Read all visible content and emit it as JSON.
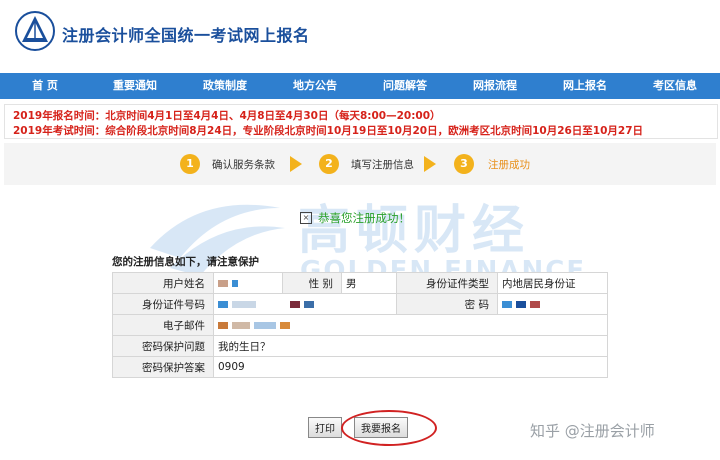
{
  "header": {
    "site_title": "注册会计师全国统一考试网上报名"
  },
  "nav": [
    "首 页",
    "重要通知",
    "政策制度",
    "地方公告",
    "问题解答",
    "网报流程",
    "网上报名",
    "考区信息"
  ],
  "notice": {
    "line1": "2019年报名时间：北京时间4月1日至4月4日、4月8日至4月30日（每天8:00—20:00）",
    "line2": "2019年考试时间：综合阶段北京时间8月24日，专业阶段北京时间10月19日至10月20日，欧洲考区北京时间10月26日至10月27日"
  },
  "steps": [
    {
      "num": "1",
      "label": "确认服务条款"
    },
    {
      "num": "2",
      "label": "填写注册信息"
    },
    {
      "num": "3",
      "label": "注册成功"
    }
  ],
  "success": {
    "message": "恭喜您注册成功！"
  },
  "info": {
    "title": "您的注册信息如下，请注意保护",
    "name_label": "用户姓名",
    "gender_label": "性  别",
    "gender_value": "男",
    "idtype_label": "身份证件类型",
    "idtype_value": "内地居民身份证",
    "idno_label": "身份证件号码",
    "pwd_label": "密  码",
    "email_label": "电子邮件",
    "question_label": "密码保护问题",
    "question_value": "我的生日？",
    "answer_label": "密码保护答案",
    "answer_value": "0909"
  },
  "buttons": {
    "print": "打印",
    "apply": "我要报名"
  },
  "watermark": {
    "cn": "高顿财经",
    "en": "GOLDEN FINANCE"
  },
  "zhihu": "知乎 @注册会计师",
  "colors": {
    "nav": "#2f7fcf",
    "notice": "#d6221a",
    "step": "#f3b21c",
    "success": "#2aa02a",
    "highlight_ring": "#d12222"
  }
}
